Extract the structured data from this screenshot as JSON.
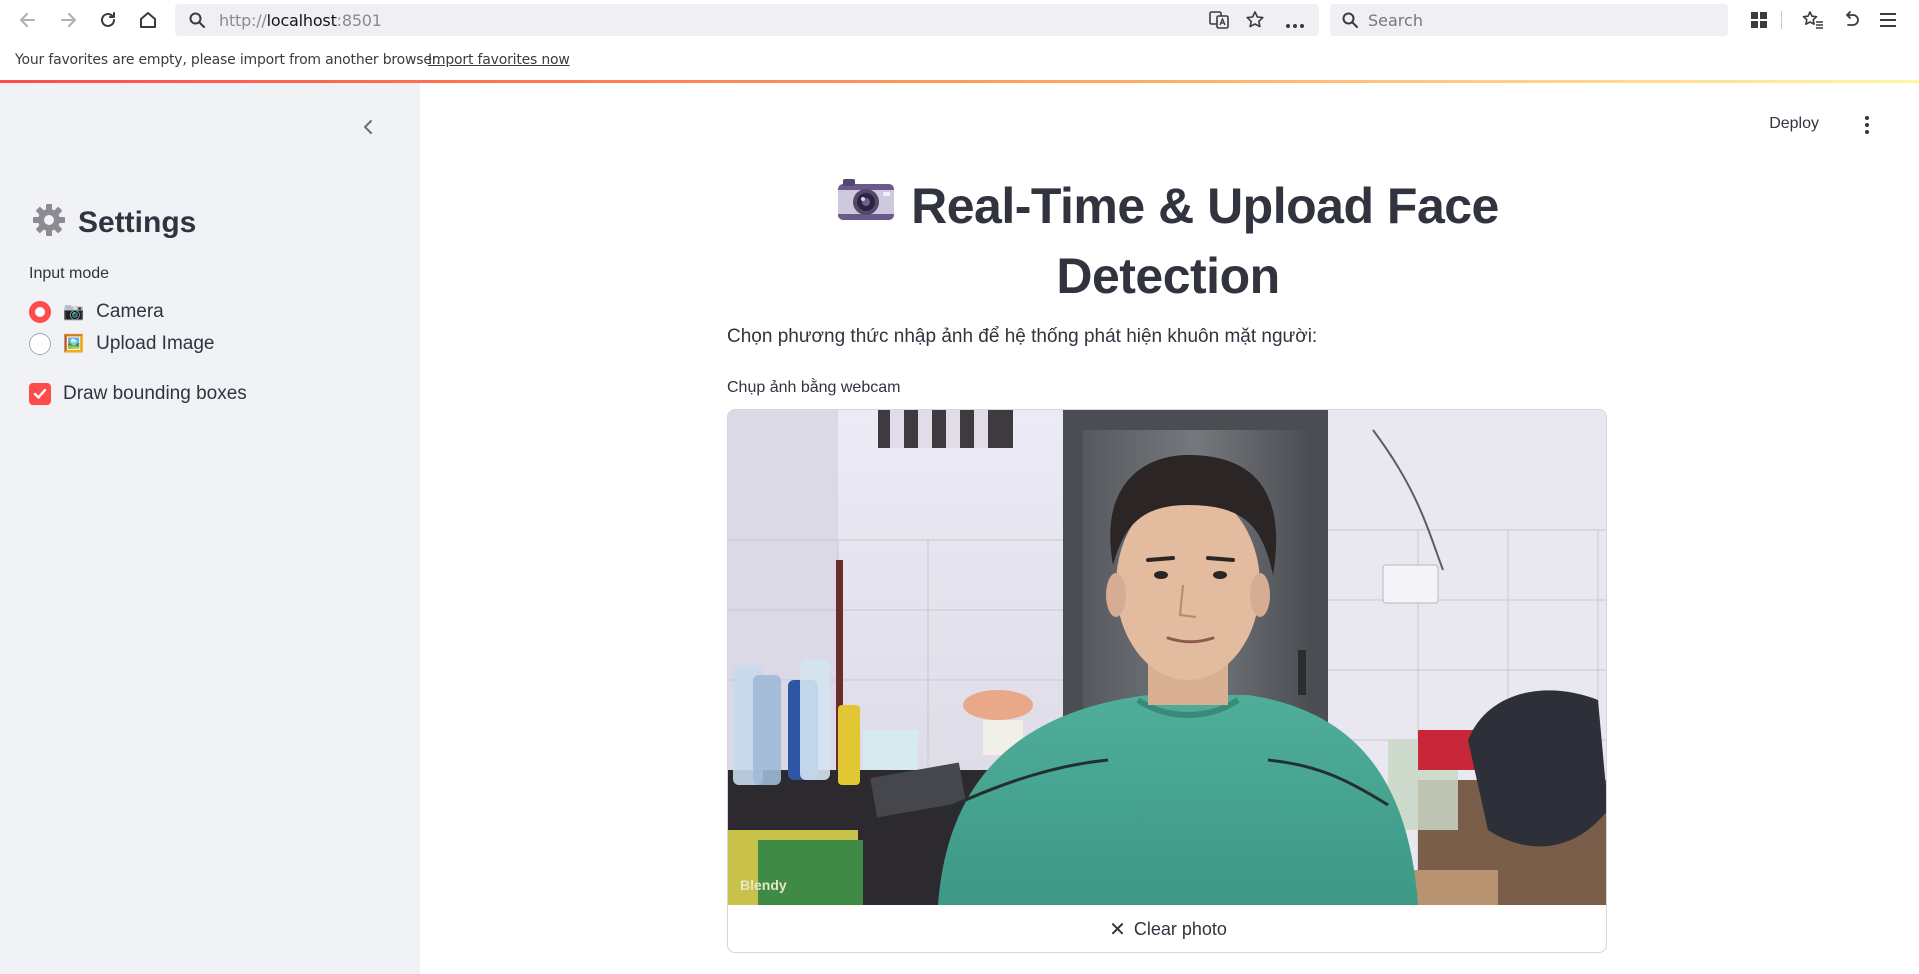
{
  "browser": {
    "url_host": "http://",
    "url_main": "localhost",
    "url_port": ":8501",
    "search_placeholder": "Search",
    "favorites_message": "Your favorites are empty, please import from another browser.",
    "favorites_link": "Import favorites now"
  },
  "sidebar": {
    "title": "Settings",
    "title_icon": "gear-icon",
    "input_mode_label": "Input mode",
    "options": [
      {
        "emoji": "📷",
        "label": "Camera",
        "selected": true
      },
      {
        "emoji": "🖼️",
        "label": "Upload Image",
        "selected": false
      }
    ],
    "checkbox_label": "Draw bounding boxes",
    "checkbox_checked": true
  },
  "header": {
    "deploy_label": "Deploy"
  },
  "main": {
    "title": "Real-Time & Upload Face Detection",
    "title_icon": "camera-icon",
    "description": "Chọn phương thức nhập ảnh để hệ thống phát hiện khuôn mặt người:",
    "camera_label": "Chụp ảnh bằng webcam",
    "clear_button": "Clear photo",
    "photo_text": "Blendy"
  },
  "colors": {
    "accent": "#ff4b4b",
    "sidebar_bg": "#f0f2f6",
    "text": "#31333f"
  }
}
